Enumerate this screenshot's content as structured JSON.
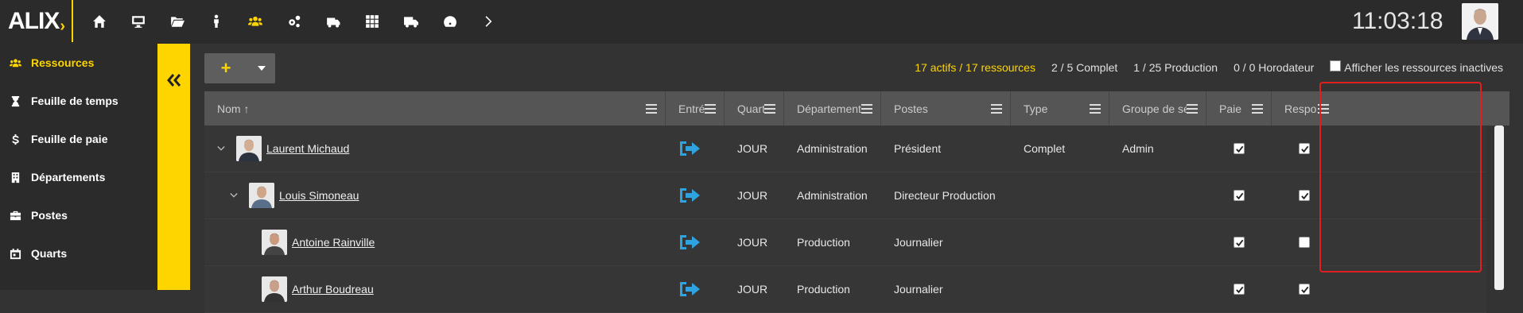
{
  "app": {
    "logo_text": "ALIX",
    "clock": "11:03:18"
  },
  "topnav": {
    "icons": [
      "home-icon",
      "desktop-icon",
      "folder-icon",
      "person-icon",
      "users-icon",
      "cogs-icon",
      "truck-icon",
      "grid-icon",
      "delivery-truck-icon",
      "gauge-icon",
      "chevron-right-icon"
    ],
    "active_icon": "users-icon"
  },
  "sidebar": {
    "items": [
      {
        "label": "Ressources",
        "icon": "users-icon",
        "active": true
      },
      {
        "label": "Feuille de temps",
        "icon": "hourglass-icon",
        "active": false
      },
      {
        "label": "Feuille de paie",
        "icon": "dollar-icon",
        "active": false
      },
      {
        "label": "Départements",
        "icon": "building-icon",
        "active": false
      },
      {
        "label": "Postes",
        "icon": "briefcase-icon",
        "active": false
      },
      {
        "label": "Quarts",
        "icon": "calendar-icon",
        "active": false
      }
    ]
  },
  "toolbar": {
    "add_label": "+",
    "stats": {
      "active": "17 actifs / 17 ressources",
      "complet": "2 / 5 Complet",
      "production": "1 / 25 Production",
      "horodateur": "0 / 0 Horodateur"
    },
    "show_inactive_label": "Afficher les ressources inactives"
  },
  "table": {
    "columns": [
      {
        "key": "nom",
        "label": "Nom ↑"
      },
      {
        "key": "entree",
        "label": "Entré..."
      },
      {
        "key": "quart",
        "label": "Quart"
      },
      {
        "key": "departement",
        "label": "Département"
      },
      {
        "key": "postes",
        "label": "Postes"
      },
      {
        "key": "type",
        "label": "Type"
      },
      {
        "key": "groupe",
        "label": "Groupe de séc..."
      },
      {
        "key": "paie",
        "label": "Paie"
      },
      {
        "key": "respo",
        "label": "Respo..."
      }
    ],
    "rows": [
      {
        "nom": "Laurent Michaud",
        "quart": "JOUR",
        "departement": "Administration",
        "postes": "Président",
        "type": "Complet",
        "groupe": "Admin",
        "paie": true,
        "respo": true
      },
      {
        "nom": "Louis Simoneau",
        "quart": "JOUR",
        "departement": "Administration",
        "postes": "Directeur Production",
        "type": "",
        "groupe": "",
        "paie": true,
        "respo": true
      },
      {
        "nom": "Antoine Rainville",
        "quart": "JOUR",
        "departement": "Production",
        "postes": "Journalier",
        "type": "",
        "groupe": "",
        "paie": true,
        "respo": false
      },
      {
        "nom": "Arthur Boudreau",
        "quart": "JOUR",
        "departement": "Production",
        "postes": "Journalier",
        "type": "",
        "groupe": "",
        "paie": true,
        "respo": true
      }
    ]
  },
  "colors": {
    "accent": "#ffd500",
    "entry_icon": "#2ea3e0",
    "highlight": "#e02020"
  }
}
